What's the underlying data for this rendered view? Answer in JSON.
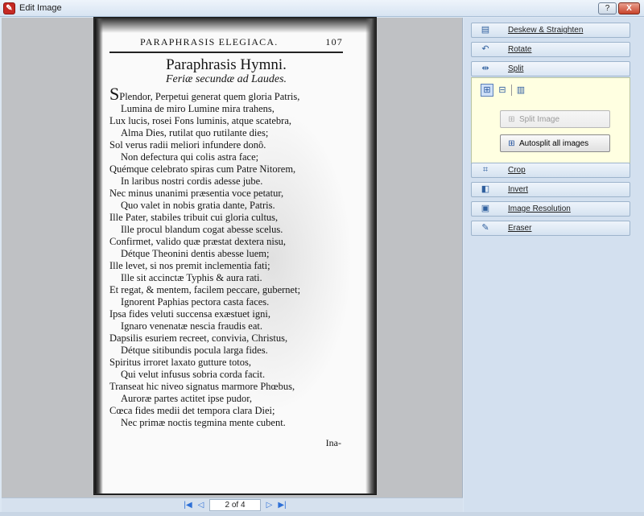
{
  "window": {
    "title": "Edit Image",
    "help_label": "?",
    "close_label": "X"
  },
  "page": {
    "running_head": "PARAPHRASIS ELEGIACA.",
    "page_number": "107",
    "title": "Paraphrasis Hymni.",
    "subtitle": "Feriæ secundæ ad Laudes.",
    "dropcap": "S",
    "first_line_rest": "Plendor, Perpetui generat quem gloria Patris,",
    "lines": [
      {
        "text": "Lumina de miro Lumine mira trahens,",
        "indent": true
      },
      {
        "text": "Lux lucis, rosei Fons luminis, atque scatebra,",
        "indent": false
      },
      {
        "text": "Alma Dies, rutilat quo rutilante dies;",
        "indent": true
      },
      {
        "text": "Sol verus radii meliori infundere donô.",
        "indent": false
      },
      {
        "text": "Non defectura qui colis astra face;",
        "indent": true
      },
      {
        "text": "Quémque celebrato spiras cum Patre Nitorem,",
        "indent": false
      },
      {
        "text": "In laribus nostri cordis adesse jube.",
        "indent": true
      },
      {
        "text": "Nec minus unanimi præsentia voce petatur,",
        "indent": false
      },
      {
        "text": "Quo valet in nobis gratia dante, Patris.",
        "indent": true
      },
      {
        "text": "Ille Pater, stabiles tribuit cui gloria cultus,",
        "indent": false
      },
      {
        "text": "Ille procul blandum cogat abesse scelus.",
        "indent": true
      },
      {
        "text": "Confirmet, valido quæ præstat dextera nisu,",
        "indent": false
      },
      {
        "text": "Détque Theonini dentis abesse luem;",
        "indent": true
      },
      {
        "text": "Ille levet, si nos premit inclementia fati;",
        "indent": false
      },
      {
        "text": "Ille sit accinctæ Typhis & aura rati.",
        "indent": true
      },
      {
        "text": "Et regat, & mentem, facilem peccare, gubernet;",
        "indent": false
      },
      {
        "text": "Ignorent Paphias pectora casta faces.",
        "indent": true
      },
      {
        "text": "Ipsa fides veluti succensa exæstuet igni,",
        "indent": false
      },
      {
        "text": "Ignaro venenatæ nescia fraudis eat.",
        "indent": true
      },
      {
        "text": "Dapsilis esuriem recreet, convivia, Christus,",
        "indent": false
      },
      {
        "text": "Détque sitibundis pocula larga fides.",
        "indent": true
      },
      {
        "text": "Spiritus irroret laxato gutture totos,",
        "indent": false
      },
      {
        "text": "Qui velut infusus sobria corda facit.",
        "indent": true
      },
      {
        "text": "Transeat hic niveo signatus marmore Phœbus,",
        "indent": false
      },
      {
        "text": "Auroræ partes actitet ipse pudor,",
        "indent": true
      },
      {
        "text": "Cœca fides medii det tempora clara Diei;",
        "indent": false
      },
      {
        "text": "Nec primæ noctis tegmina mente cubent.",
        "indent": true
      }
    ],
    "catchword": "Ina-"
  },
  "pager": {
    "indicator": "2 of 4",
    "first_icon": "first-page-icon",
    "prev_icon": "prev-page-icon",
    "next_icon": "next-page-icon",
    "last_icon": "last-page-icon"
  },
  "tools": {
    "deskew": "Deskew & Straighten",
    "rotate": "Rotate",
    "split": "Split",
    "crop": "Crop",
    "invert": "Invert",
    "resolution": "Image Resolution",
    "eraser": "Eraser"
  },
  "split_panel": {
    "split_image": "Split Image",
    "autosplit": "Autosplit all images"
  },
  "colors": {
    "panel_bg": "#d3e0ef",
    "split_pane_bg": "#ffffe1",
    "viewer_bg": "#bfc1c4"
  }
}
